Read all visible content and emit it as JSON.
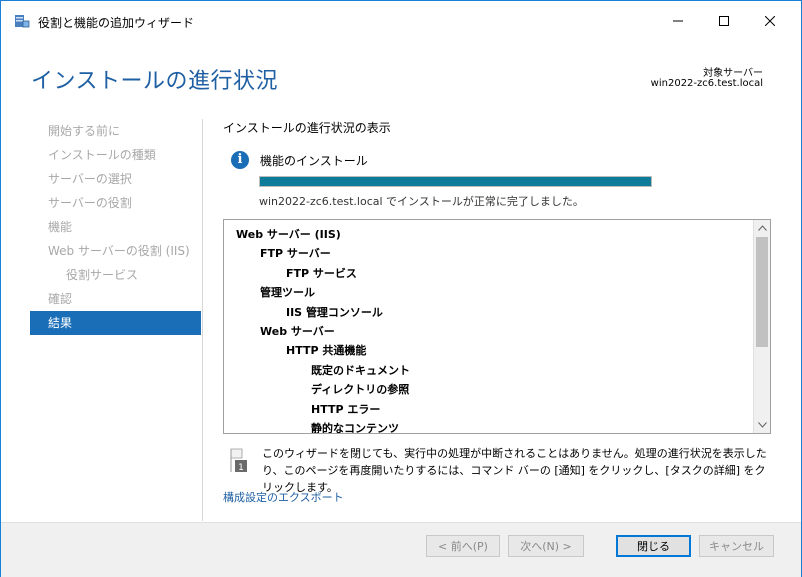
{
  "window": {
    "title": "役割と機能の追加ウィザード"
  },
  "header": {
    "page_title": "インストールの進行状況",
    "target_label": "対象サーバー",
    "target_name": "win2022-zc6.test.local"
  },
  "nav": {
    "items": [
      {
        "label": "開始する前に",
        "state": "disabled"
      },
      {
        "label": "インストールの種類",
        "state": "disabled"
      },
      {
        "label": "サーバーの選択",
        "state": "disabled"
      },
      {
        "label": "サーバーの役割",
        "state": "disabled"
      },
      {
        "label": "機能",
        "state": "disabled"
      },
      {
        "label": "Web サーバーの役割 (IIS)",
        "state": "disabled"
      },
      {
        "label": "役割サービス",
        "state": "disabled",
        "sub": true
      },
      {
        "label": "確認",
        "state": "disabled"
      },
      {
        "label": "結果",
        "state": "active"
      }
    ]
  },
  "content": {
    "section_title": "インストールの進行状況の表示",
    "feature_title": "機能のインストール",
    "progress": 1.0,
    "status_text": "win2022-zc6.test.local でインストールが正常に完了しました。",
    "results": [
      {
        "label": "Web サーバー (IIS)",
        "level": 0
      },
      {
        "label": "FTP サーバー",
        "level": 1
      },
      {
        "label": "FTP サービス",
        "level": 2
      },
      {
        "label": "管理ツール",
        "level": 1
      },
      {
        "label": "IIS 管理コンソール",
        "level": 2
      },
      {
        "label": "Web サーバー",
        "level": 1
      },
      {
        "label": "HTTP 共通機能",
        "level": 2
      },
      {
        "label": "既定のドキュメント",
        "level": 3
      },
      {
        "label": "ディレクトリの参照",
        "level": 3
      },
      {
        "label": "HTTP エラー",
        "level": 3
      },
      {
        "label": "静的なコンテンツ",
        "level": 3
      }
    ],
    "note_badge": "1",
    "note_text": "このウィザードを閉じても、実行中の処理が中断されることはありません。処理の進行状況を表示したり、このページを再度開いたりするには、コマンド バーの [通知] をクリックし、[タスクの詳細] をクリックします。",
    "export_link": "構成設定のエクスポート"
  },
  "footer": {
    "prev_label": "< 前へ(P)",
    "next_label": "次へ(N) >",
    "close_label": "閉じる",
    "cancel_label": "キャンセル"
  },
  "colors": {
    "accent": "#1a6eb8",
    "title_blue": "#1f5fa3",
    "progress_fill": "#0e7c99"
  }
}
